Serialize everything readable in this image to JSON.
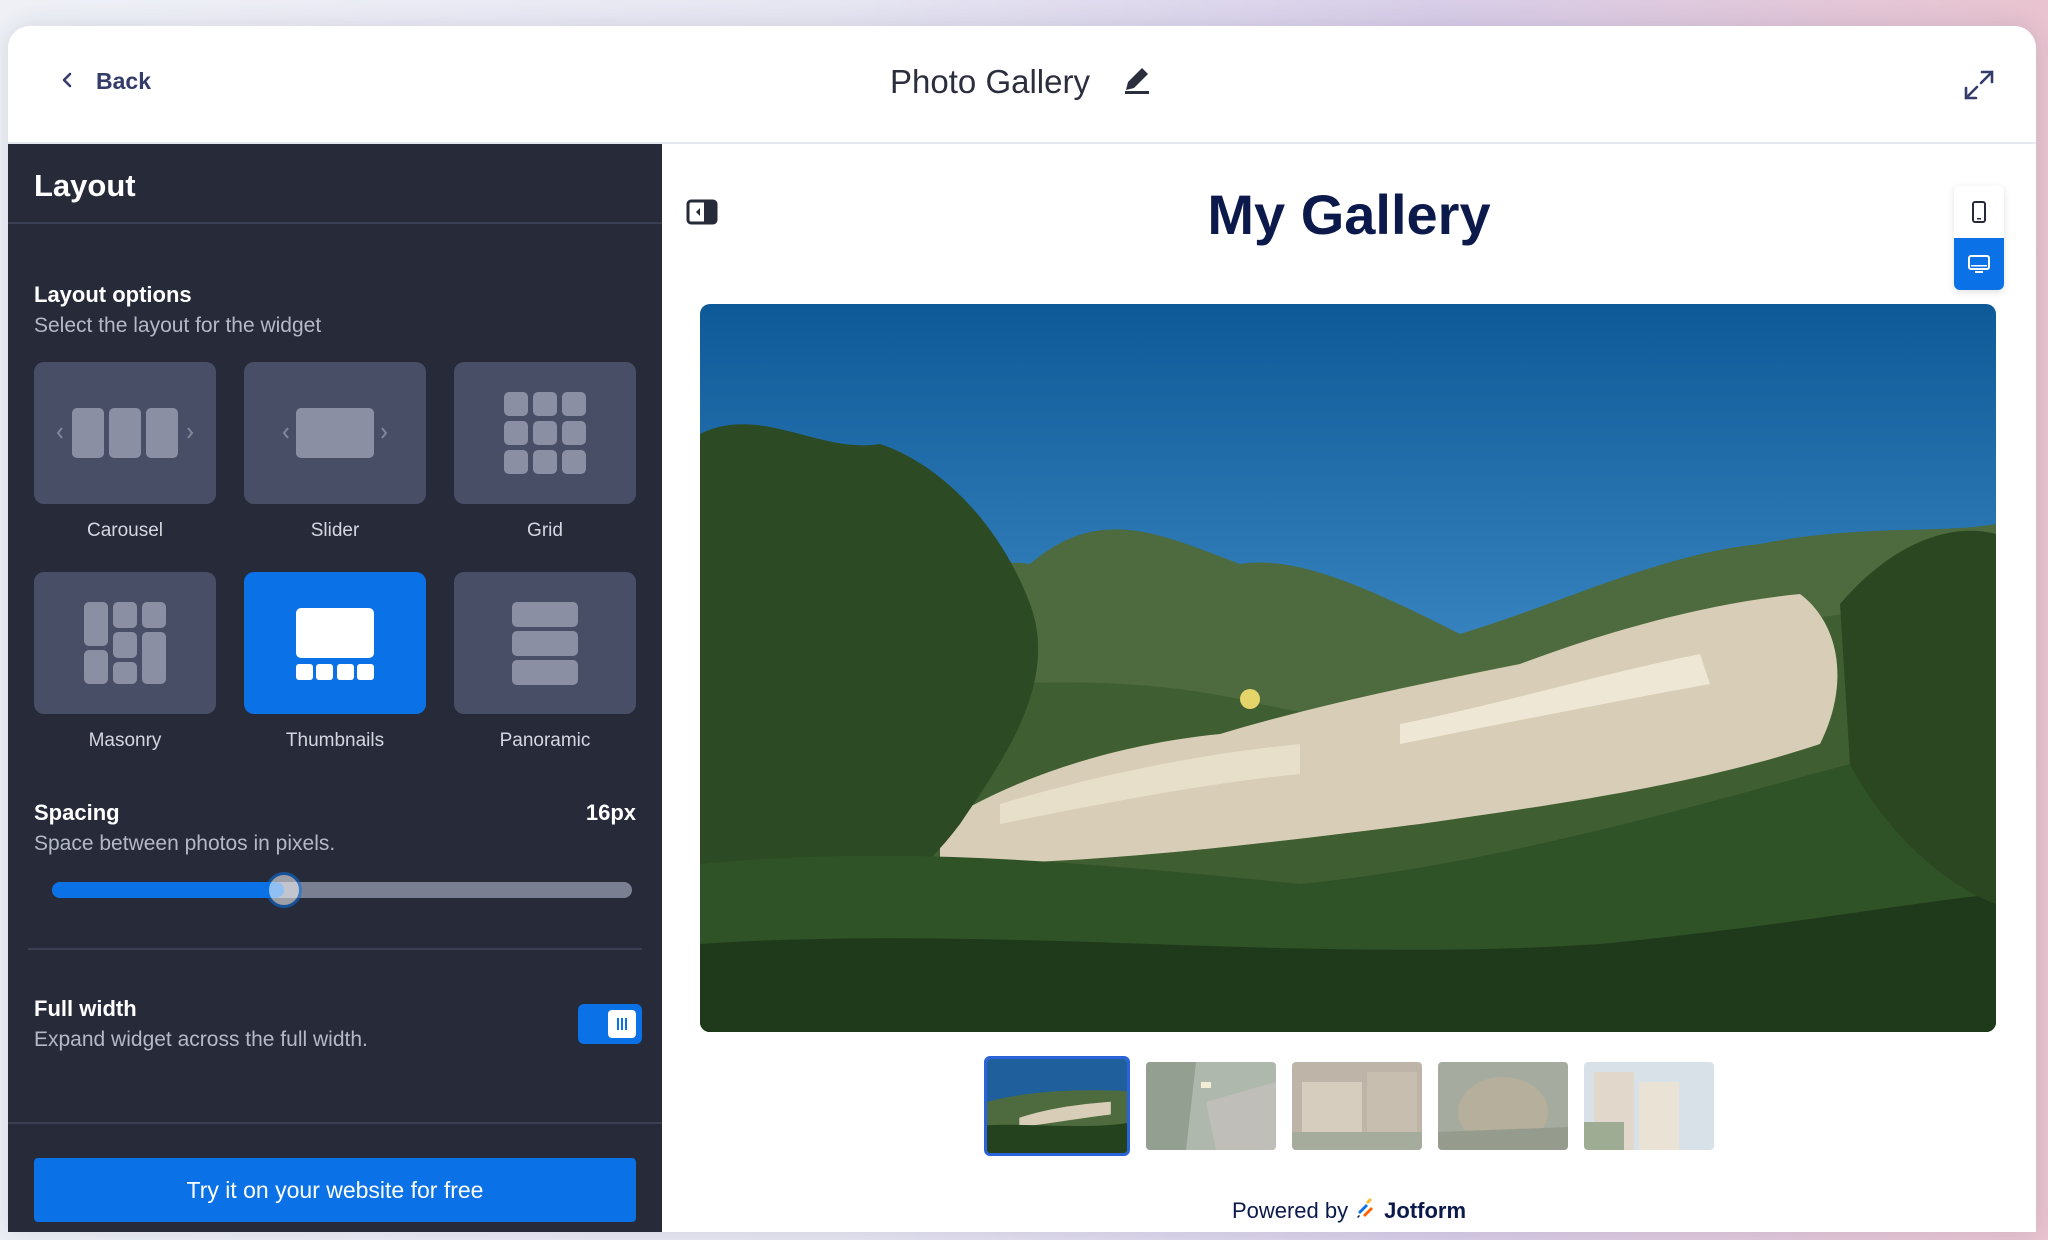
{
  "header": {
    "back_label": "Back",
    "title": "Photo Gallery"
  },
  "sidebar": {
    "title": "Layout",
    "layout_options": {
      "title": "Layout options",
      "subtitle": "Select the layout for the widget",
      "items": [
        {
          "label": "Carousel",
          "icon": "carousel-icon",
          "selected": false
        },
        {
          "label": "Slider",
          "icon": "slider-icon",
          "selected": false
        },
        {
          "label": "Grid",
          "icon": "grid-icon",
          "selected": false
        },
        {
          "label": "Masonry",
          "icon": "masonry-icon",
          "selected": false
        },
        {
          "label": "Thumbnails",
          "icon": "thumbnails-icon",
          "selected": true
        },
        {
          "label": "Panoramic",
          "icon": "panoramic-icon",
          "selected": false
        }
      ]
    },
    "spacing": {
      "title": "Spacing",
      "subtitle": "Space between photos in pixels.",
      "value_label": "16px",
      "slider_fraction": 0.4
    },
    "full_width": {
      "title": "Full width",
      "subtitle": "Expand widget across the full width.",
      "enabled": true
    },
    "cta_label": "Try it on your website for free"
  },
  "preview": {
    "gallery_title": "My Gallery",
    "device_modes": [
      "mobile",
      "desktop"
    ],
    "active_device": "desktop",
    "thumbnail_count": 5,
    "active_thumbnail": 0,
    "powered_by_prefix": "Powered by",
    "powered_by_brand": "Jotform"
  },
  "colors": {
    "accent": "#0a72e6",
    "sidebar_bg": "#262a39",
    "tile_bg": "#484e66",
    "title_navy": "#0c1a4b"
  }
}
